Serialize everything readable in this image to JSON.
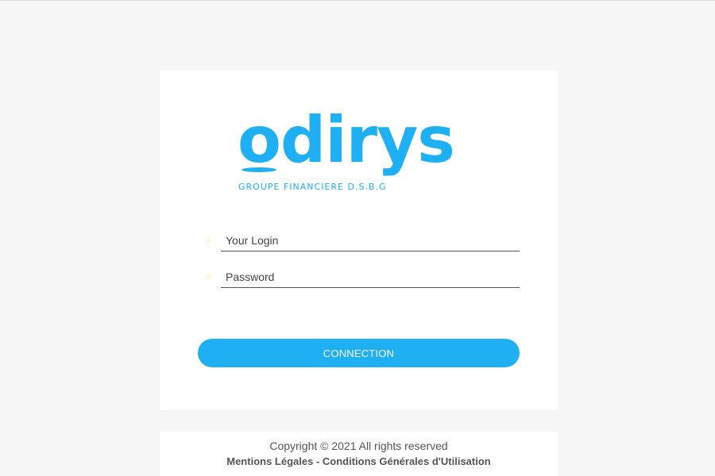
{
  "brand": {
    "name": "odirys",
    "tagline": "GROUPE FINANCIERE D.S.B.G",
    "color": "#1fb0f3"
  },
  "form": {
    "login_placeholder": "Your Login",
    "password_placeholder": "Password",
    "login_icon": "user-icon",
    "password_icon": "lock-icon",
    "submit_label": "CONNECTION",
    "button_color": "#1fb0f3"
  },
  "footer": {
    "copyright": "Copyright © 2021 All rights reserved",
    "link_legal": "Mentions Légales",
    "separator": " - ",
    "link_terms": "Conditions Générales d'Utilisation"
  }
}
